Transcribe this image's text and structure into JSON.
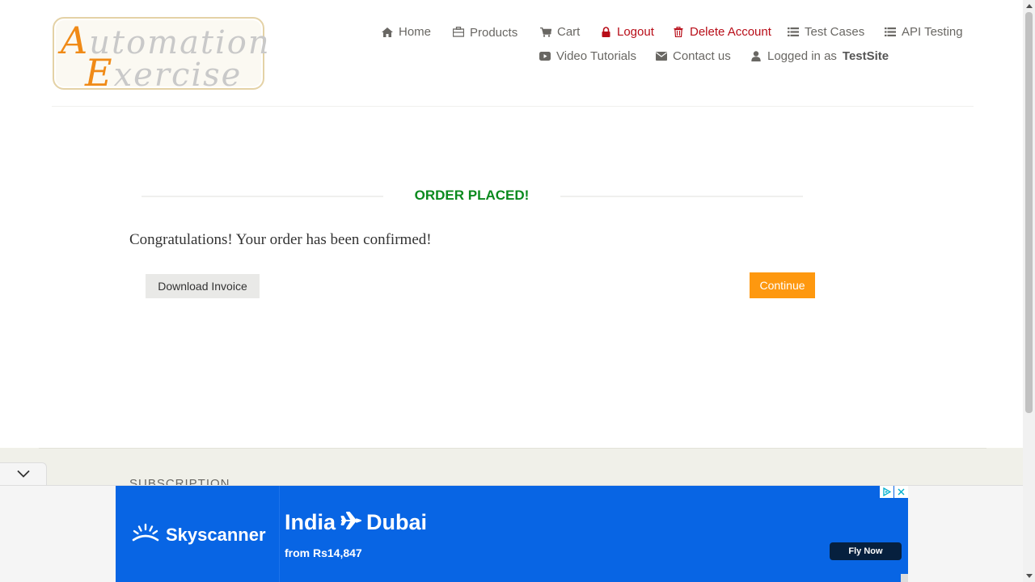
{
  "logo": {
    "line1_cap": "A",
    "line1_rest": "utomation",
    "line2_cap": "E",
    "line2_rest": "xercise"
  },
  "nav": {
    "home": "Home",
    "products": "Products",
    "cart": "Cart",
    "logout": "Logout",
    "delete_account": "Delete Account",
    "test_cases": "Test Cases",
    "api_testing": "API Testing",
    "video_tutorials": "Video Tutorials",
    "contact_us": "Contact us",
    "logged_in_prefix": "Logged in as",
    "username": "TestSite"
  },
  "main": {
    "title": "ORDER PLACED!",
    "message": "Congratulations! Your order has been confirmed!",
    "download_invoice": "Download Invoice",
    "continue": "Continue"
  },
  "footer": {
    "subscription_title": "SUBSCRIPTION"
  },
  "ad": {
    "brand": "Skyscanner",
    "origin": "India",
    "destination": "Dubai",
    "price": "from Rs14,847",
    "cta": "Fly Now"
  },
  "colors": {
    "accent": "#fe980f",
    "success": "#0a8a1e",
    "danger": "#b80d18",
    "ad_blue": "#0865e4"
  }
}
